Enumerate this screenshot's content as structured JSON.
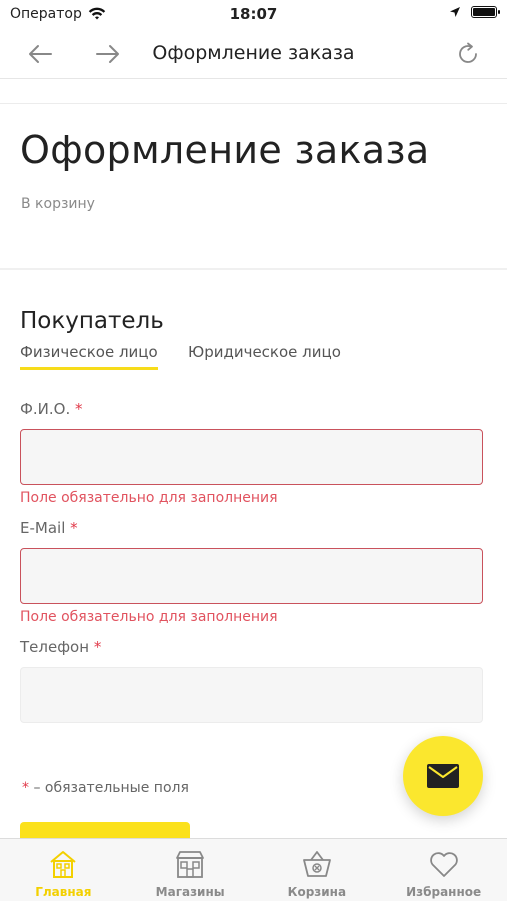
{
  "status_bar": {
    "carrier": "Оператор",
    "time": "18:07"
  },
  "nav": {
    "title": "Оформление заказа"
  },
  "page": {
    "title": "Оформление заказа",
    "back_link": "В корзину"
  },
  "buyer": {
    "section_title": "Покупатель",
    "tabs": [
      {
        "label": "Физическое лицо",
        "active": true
      },
      {
        "label": "Юридическое лицо",
        "active": false
      }
    ]
  },
  "form": {
    "name_label": "Ф.И.О.",
    "name_value": "",
    "name_error": "Поле обязательно для заполнения",
    "email_label": "E-Mail",
    "email_value": "",
    "email_error": "Поле обязательно для заполнения",
    "phone_label": "Телефон",
    "phone_value": "",
    "required_mark": "*",
    "required_note": "– обязательные поля"
  },
  "tabbar": {
    "items": [
      {
        "label": "Главная",
        "icon": "home-icon",
        "active": true
      },
      {
        "label": "Магазины",
        "icon": "store-icon",
        "active": false
      },
      {
        "label": "Корзина",
        "icon": "basket-icon",
        "active": false
      },
      {
        "label": "Избранное",
        "icon": "heart-icon",
        "active": false
      }
    ]
  },
  "colors": {
    "accent": "#fbe11c",
    "error": "#e1535f",
    "active_tab": "#f3d000"
  }
}
